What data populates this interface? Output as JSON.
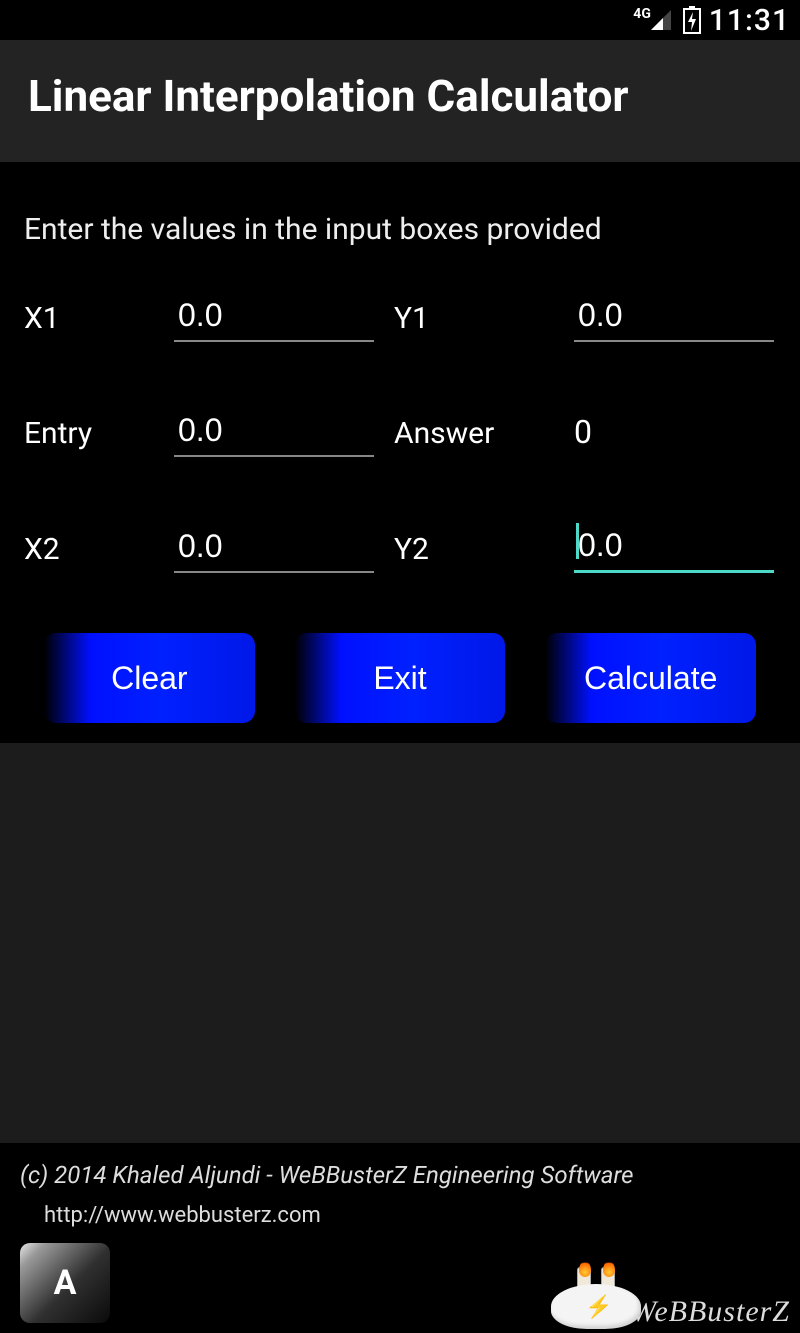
{
  "statusbar": {
    "network_label": "4G",
    "clock": "11:31"
  },
  "titlebar": {
    "title": "Linear Interpolation Calculator"
  },
  "content": {
    "instruction": "Enter the values in the input boxes provided",
    "fields": {
      "x1": {
        "label": "X1",
        "value": "0.0"
      },
      "y1": {
        "label": "Y1",
        "value": "0.0"
      },
      "entry": {
        "label": "Entry",
        "value": "0.0"
      },
      "answer": {
        "label": "Answer",
        "value": "0"
      },
      "x2": {
        "label": "X2",
        "value": "0.0"
      },
      "y2": {
        "label": "Y2",
        "value": "0.0"
      }
    },
    "buttons": {
      "clear": "Clear",
      "exit": "Exit",
      "calculate": "Calculate"
    }
  },
  "footer": {
    "copyright": "(c) 2014 Khaled Aljundi - WeBBusterZ Engineering Software",
    "url": "http://www.webbusterz.com",
    "badge_label": "A",
    "logo_text": "WeBBusterZ"
  }
}
